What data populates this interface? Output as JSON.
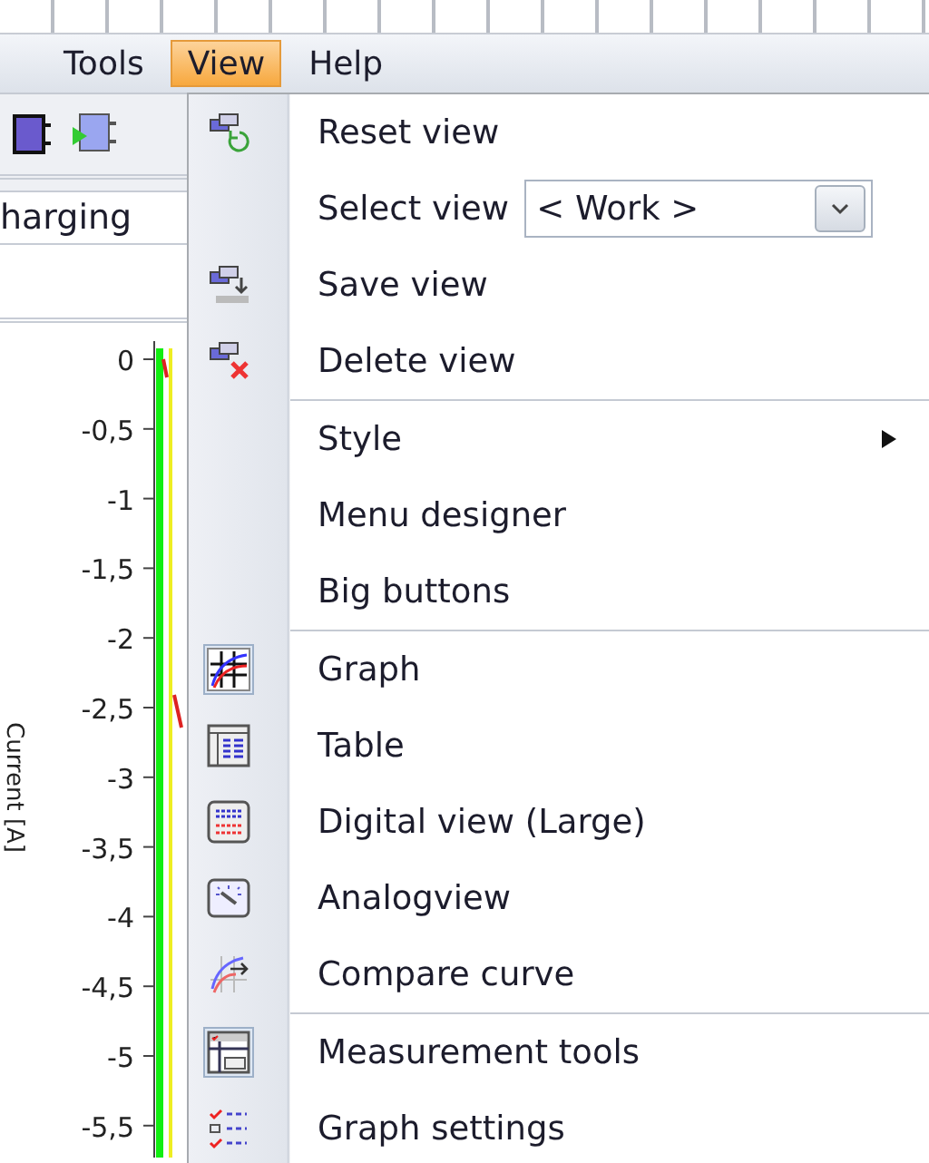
{
  "menubar": [
    {
      "label": "Tools",
      "selected": false
    },
    {
      "label": "View",
      "selected": true
    },
    {
      "label": "Help",
      "selected": false
    }
  ],
  "background": {
    "mode_field": "harging",
    "chart": {
      "ylabel": "Current [A]",
      "yticks": [
        "0",
        "-0,5",
        "-1",
        "-1,5",
        "-2",
        "-2,5",
        "-3",
        "-3,5",
        "-4",
        "-4,5",
        "-5",
        "-5,5"
      ]
    }
  },
  "view_menu": [
    {
      "kind": "command",
      "label": "Reset view",
      "checked": false
    },
    {
      "kind": "select",
      "label": "Select view",
      "value": "< Work >",
      "checked": false
    },
    {
      "kind": "command",
      "label": "Save view",
      "checked": false
    },
    {
      "kind": "command",
      "label": "Delete view",
      "checked": false
    },
    {
      "kind": "separator"
    },
    {
      "kind": "submenu",
      "label": "Style",
      "checked": false
    },
    {
      "kind": "command",
      "label": "Menu designer",
      "checked": false
    },
    {
      "kind": "command",
      "label": "Big buttons",
      "checked": false
    },
    {
      "kind": "separator"
    },
    {
      "kind": "command",
      "label": "Graph",
      "checked": true
    },
    {
      "kind": "command",
      "label": "Table",
      "checked": false
    },
    {
      "kind": "command",
      "label": "Digital view (Large)",
      "checked": false
    },
    {
      "kind": "command",
      "label": "Analogview",
      "checked": false
    },
    {
      "kind": "command",
      "label": "Compare curve",
      "checked": false
    },
    {
      "kind": "separator"
    },
    {
      "kind": "command",
      "label": "Measurement tools",
      "checked": true
    },
    {
      "kind": "command",
      "label": "Graph settings",
      "checked": false
    }
  ]
}
